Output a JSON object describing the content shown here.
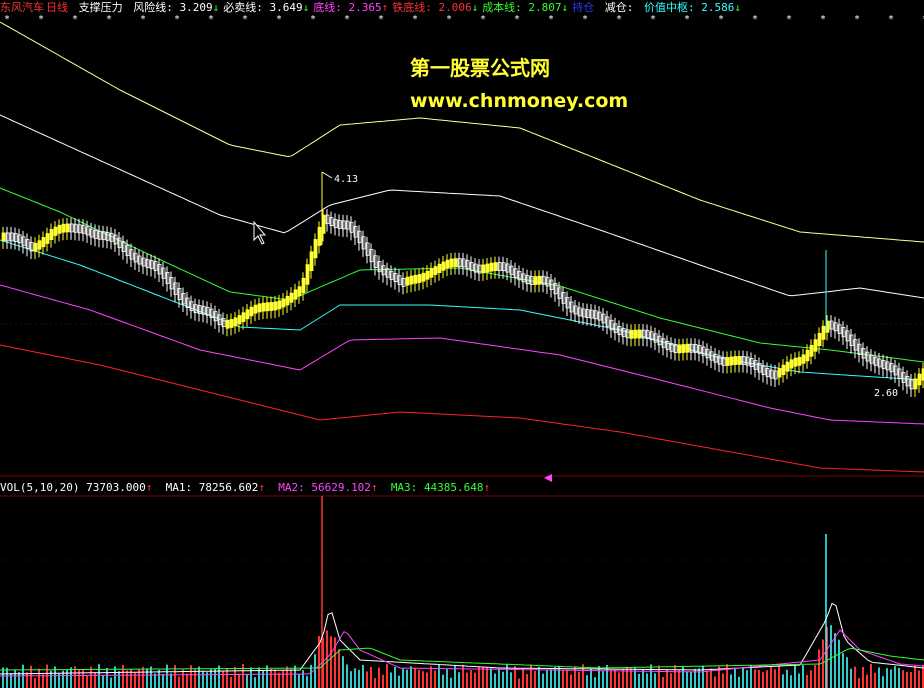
{
  "header": {
    "stock": "东风汽车",
    "period": "日线",
    "indicator": "支撑压力",
    "items": [
      {
        "label": "风险线:",
        "value": "3.209",
        "arrow": "↓",
        "color": "#ffffff"
      },
      {
        "label": "必卖线:",
        "value": "3.649",
        "arrow": "↓",
        "color": "#ffffff"
      },
      {
        "label": "底线:",
        "value": "2.365",
        "arrow": "↑",
        "color": "#ff44ff"
      },
      {
        "label": "铁底线:",
        "value": "2.006",
        "arrow": "↓",
        "color": "#ff3333"
      },
      {
        "label": "成本线:",
        "value": "2.807",
        "arrow": "↓",
        "color": "#33ff33"
      },
      {
        "label": "持仓",
        "value": "",
        "arrow": "",
        "color": "#3333ff"
      },
      {
        "label": "减仓:",
        "value": "",
        "arrow": "",
        "color": "#ffffff"
      },
      {
        "label": "价值中枢:",
        "value": "2.586",
        "arrow": "↓",
        "color": "#33ffff"
      }
    ]
  },
  "watermark": {
    "line1": "第一股票公式网",
    "line2": "www.chnmoney.com"
  },
  "chart_annotations": {
    "high_label": "4.13",
    "low_label": "2.60"
  },
  "volume": {
    "name": "VOL(5,10,20)",
    "value": "73703.000",
    "value_arrow": "↑",
    "ma1_label": "MA1:",
    "ma1": "78256.602",
    "ma1_arrow": "↑",
    "ma2_label": "MA2:",
    "ma2": "56629.102",
    "ma2_arrow": "↑",
    "ma3_label": "MA3:",
    "ma3": "44385.648",
    "ma3_arrow": "↑"
  },
  "colors": {
    "background": "#000000",
    "bull": "#ffff33",
    "bear": "#ffffff",
    "risk": "#ffffff",
    "sell": "#ffff99",
    "cost": "#33ff33",
    "value_center": "#33ffff",
    "bottom": "#ff44ff",
    "iron_bottom": "#ff2222",
    "ma1": "#ffffff",
    "ma2": "#ff44ff",
    "ma3": "#33ff33"
  }
}
